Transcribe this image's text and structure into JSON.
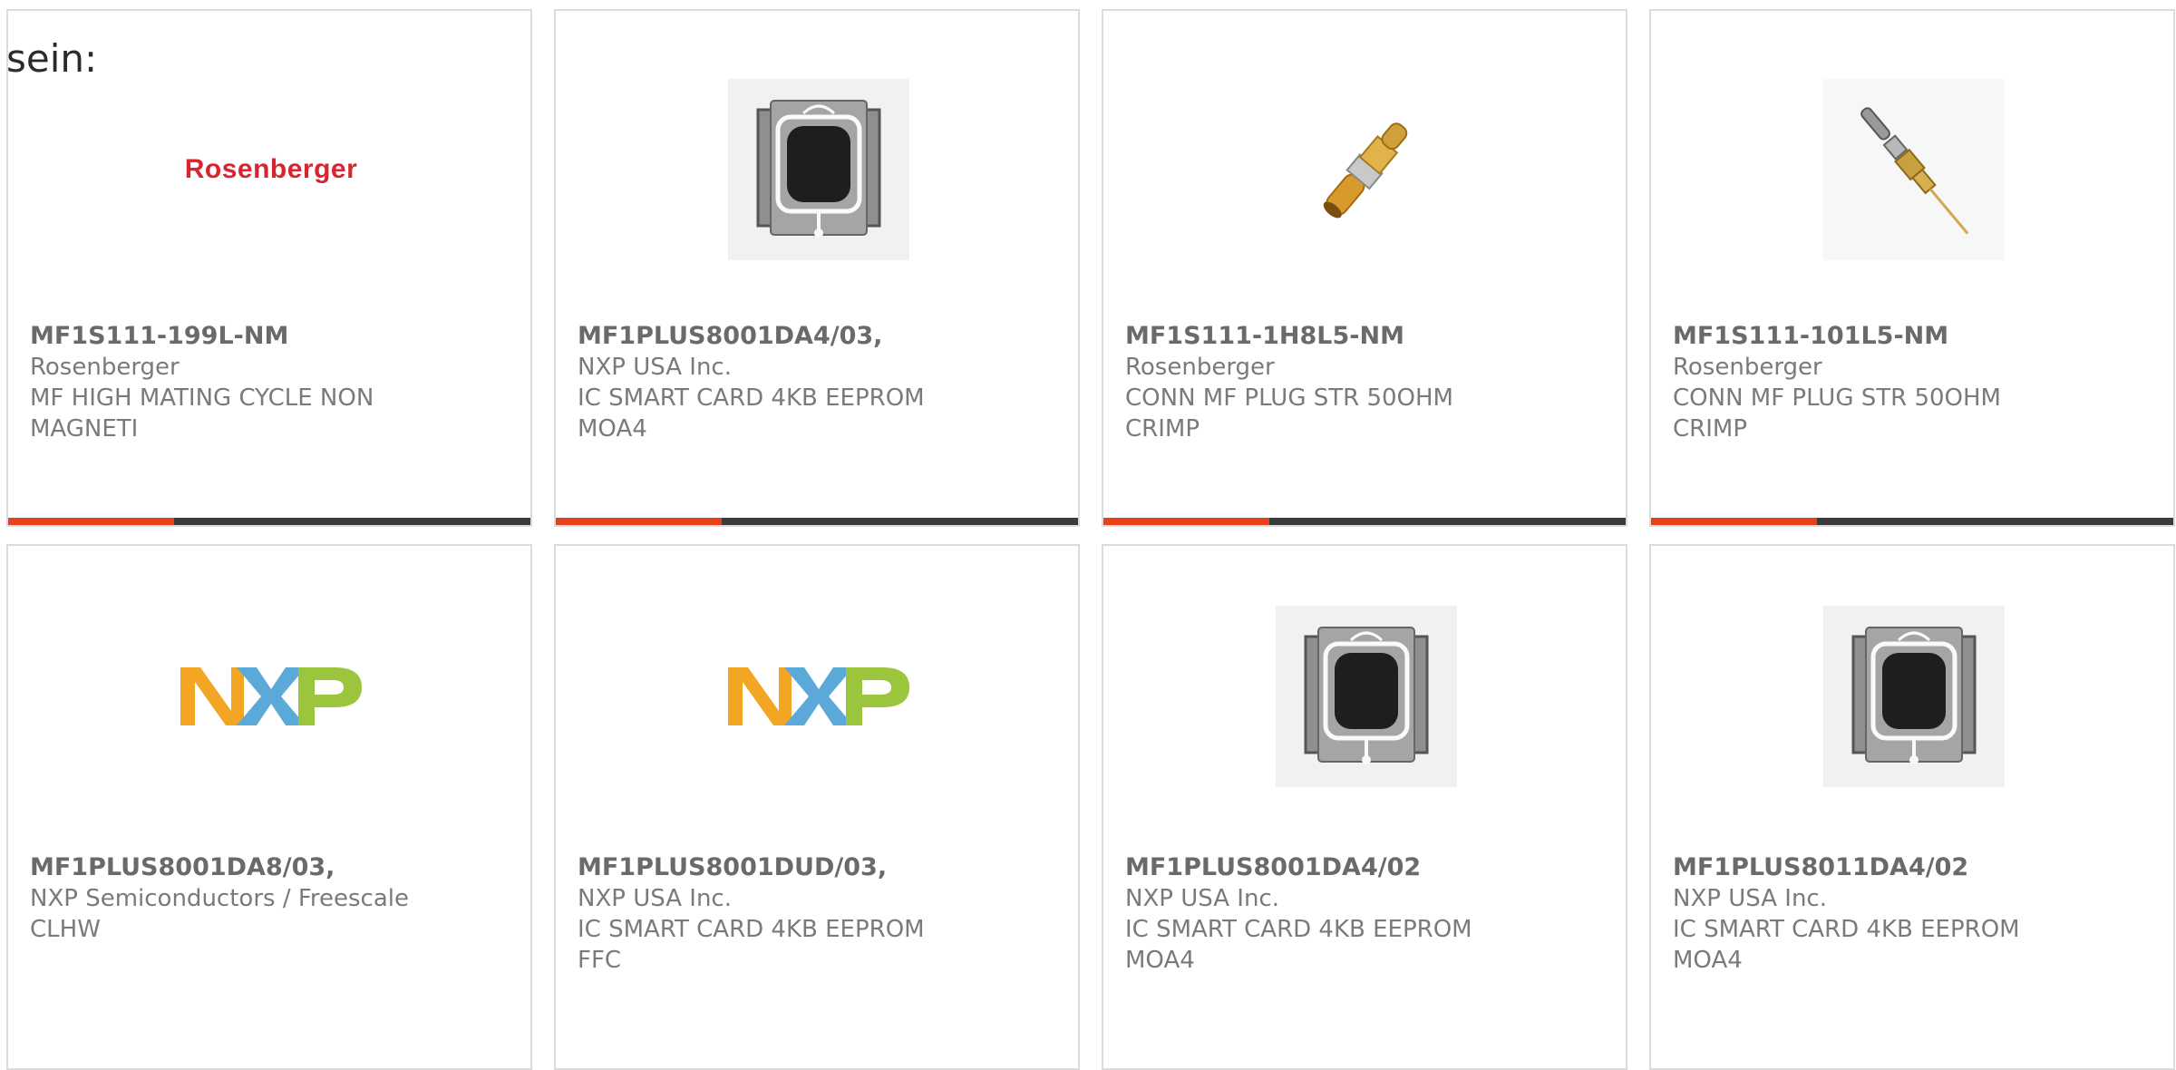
{
  "lead_text": "sein:",
  "colors": {
    "accent": "#e8401c",
    "bar": "#3b3b3b",
    "rosenberger_red": "#d9252f",
    "nxp_orange": "#f2a623",
    "nxp_blue": "#5aa9d8",
    "nxp_green": "#9bc53d"
  },
  "products": [
    {
      "part_no": "MF1S111-199L-NM",
      "manufacturer": "Rosenberger",
      "description": "MF HIGH MATING CYCLE NON\nMAGNETI",
      "image": "rosenberger-logo",
      "logo_text": "Rosenberger"
    },
    {
      "part_no": "MF1PLUS8001DA4/03,",
      "manufacturer": "NXP USA Inc.",
      "description": "IC SMART CARD 4KB EEPROM\nMOA4",
      "image": "smart-card-chip"
    },
    {
      "part_no": "MF1S111-1H8L5-NM",
      "manufacturer": "Rosenberger",
      "description": "CONN MF PLUG STR 50OHM\nCRIMP",
      "image": "connector-plug"
    },
    {
      "part_no": "MF1S111-101L5-NM",
      "manufacturer": "Rosenberger",
      "description": "CONN MF PLUG STR 50OHM\nCRIMP",
      "image": "connector-plug-with-pin"
    },
    {
      "part_no": "MF1PLUS8001DA8/03,",
      "manufacturer": "NXP Semiconductors / Freescale",
      "description": "CLHW",
      "image": "nxp-logo"
    },
    {
      "part_no": "MF1PLUS8001DUD/03,",
      "manufacturer": "NXP USA Inc.",
      "description": "IC SMART CARD 4KB EEPROM\nFFC",
      "image": "nxp-logo"
    },
    {
      "part_no": "MF1PLUS8001DA4/02",
      "manufacturer": "NXP USA Inc.",
      "description": "IC SMART CARD 4KB EEPROM\nMOA4",
      "image": "smart-card-chip"
    },
    {
      "part_no": "MF1PLUS8011DA4/02",
      "manufacturer": "NXP USA Inc.",
      "description": "IC SMART CARD 4KB EEPROM\nMOA4",
      "image": "smart-card-chip"
    }
  ]
}
